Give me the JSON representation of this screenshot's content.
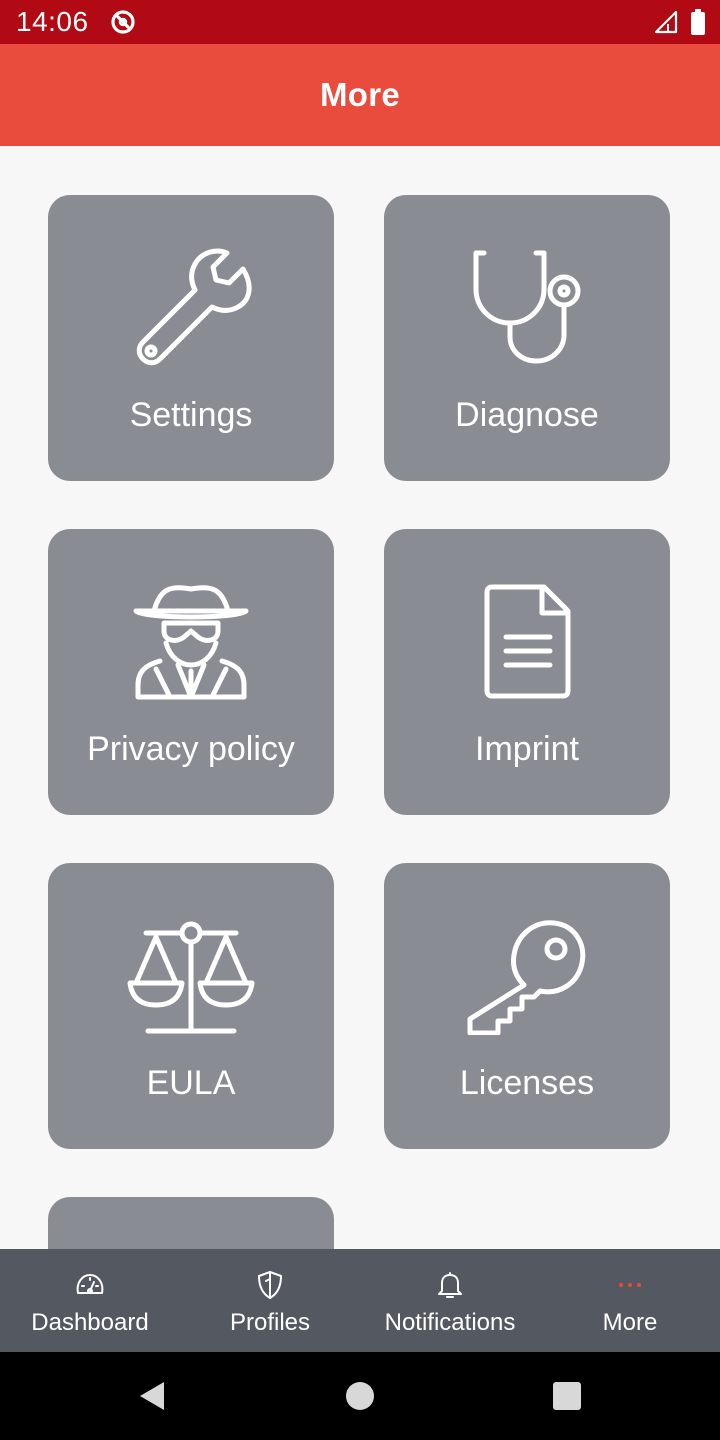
{
  "status_bar": {
    "time": "14:06",
    "background_color": "#b10a14"
  },
  "app_bar": {
    "title": "More",
    "background_color": "#e94c3c"
  },
  "tiles": [
    {
      "label": "Settings",
      "icon": "wrench-icon"
    },
    {
      "label": "Diagnose",
      "icon": "stethoscope-icon"
    },
    {
      "label": "Privacy policy",
      "icon": "spy-icon"
    },
    {
      "label": "Imprint",
      "icon": "document-icon"
    },
    {
      "label": "EULA",
      "icon": "scales-icon"
    },
    {
      "label": "Licenses",
      "icon": "key-icon"
    }
  ],
  "bottom_nav": {
    "items": [
      {
        "label": "Dashboard",
        "icon": "gauge-icon",
        "active": false
      },
      {
        "label": "Profiles",
        "icon": "shield-icon",
        "active": false
      },
      {
        "label": "Notifications",
        "icon": "bell-icon",
        "active": false
      },
      {
        "label": "More",
        "icon": "dots-icon",
        "active": true
      }
    ],
    "active_color": "#e94c3c",
    "background_color": "#545861"
  },
  "tile_color": "#898c93"
}
